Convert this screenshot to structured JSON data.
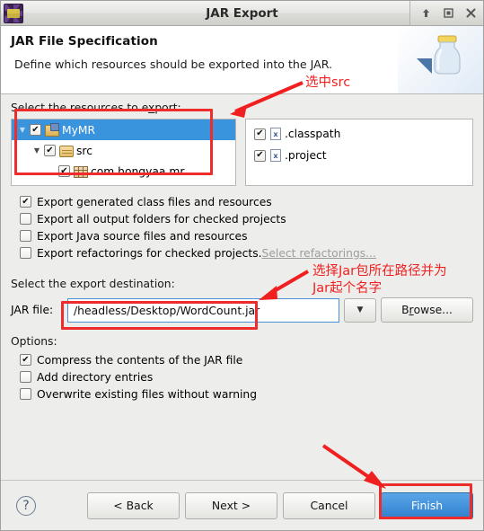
{
  "window": {
    "title": "JAR Export",
    "app_icon": "eclipse-ide-icon",
    "controls": {
      "minimize_label": "⇧",
      "maximize_label": "▢",
      "close_label": "✕"
    }
  },
  "header": {
    "title": "JAR File Specification",
    "subtitle": "Define which resources should be exported into the JAR.",
    "graphic": "jar-bottle-icon"
  },
  "resources": {
    "label": "Select the resources to export:",
    "tree": [
      {
        "label": "MyMR",
        "checked": true,
        "selected": true,
        "expanded": true,
        "indent": 0,
        "icon": "project-folder-icon"
      },
      {
        "label": "src",
        "checked": true,
        "selected": false,
        "expanded": true,
        "indent": 1,
        "icon": "source-folder-icon"
      },
      {
        "label": "com.hongyaa.mr",
        "checked": true,
        "selected": false,
        "expanded": false,
        "indent": 2,
        "icon": "package-icon"
      }
    ],
    "files": [
      {
        "label": ".classpath",
        "checked": true,
        "icon": "xml-file-icon"
      },
      {
        "label": ".project",
        "checked": true,
        "icon": "xml-file-icon"
      }
    ]
  },
  "export_options": [
    {
      "label": "Export generated class files and resources",
      "checked": true
    },
    {
      "label": "Export all output folders for checked projects",
      "checked": false
    },
    {
      "label": "Export Java source files and resources",
      "checked": false
    },
    {
      "label": "Export refactorings for checked projects.",
      "checked": false,
      "link": "Select refactorings..."
    }
  ],
  "destination": {
    "label": "Select the export destination:",
    "jar_file_label": "JAR file:",
    "jar_file_value": "/headless/Desktop/WordCount.jar",
    "dropdown_icon": "chevron-down-icon",
    "browse_label": "Browse..."
  },
  "options": {
    "label": "Options:",
    "items": [
      {
        "label": "Compress the contents of the JAR file",
        "checked": true
      },
      {
        "label": "Add directory entries",
        "checked": false
      },
      {
        "label": "Overwrite existing files without warning",
        "checked": false
      }
    ]
  },
  "footer": {
    "help_label": "?",
    "back_label": "< Back",
    "next_label": "Next >",
    "cancel_label": "Cancel",
    "finish_label": "Finish"
  },
  "annotations": {
    "color": "#f12020",
    "note_select_src": "选中src",
    "note_jar_path_line1": "选择Jar包所在路径并为",
    "note_jar_path_line2": "Jar起个名字"
  }
}
